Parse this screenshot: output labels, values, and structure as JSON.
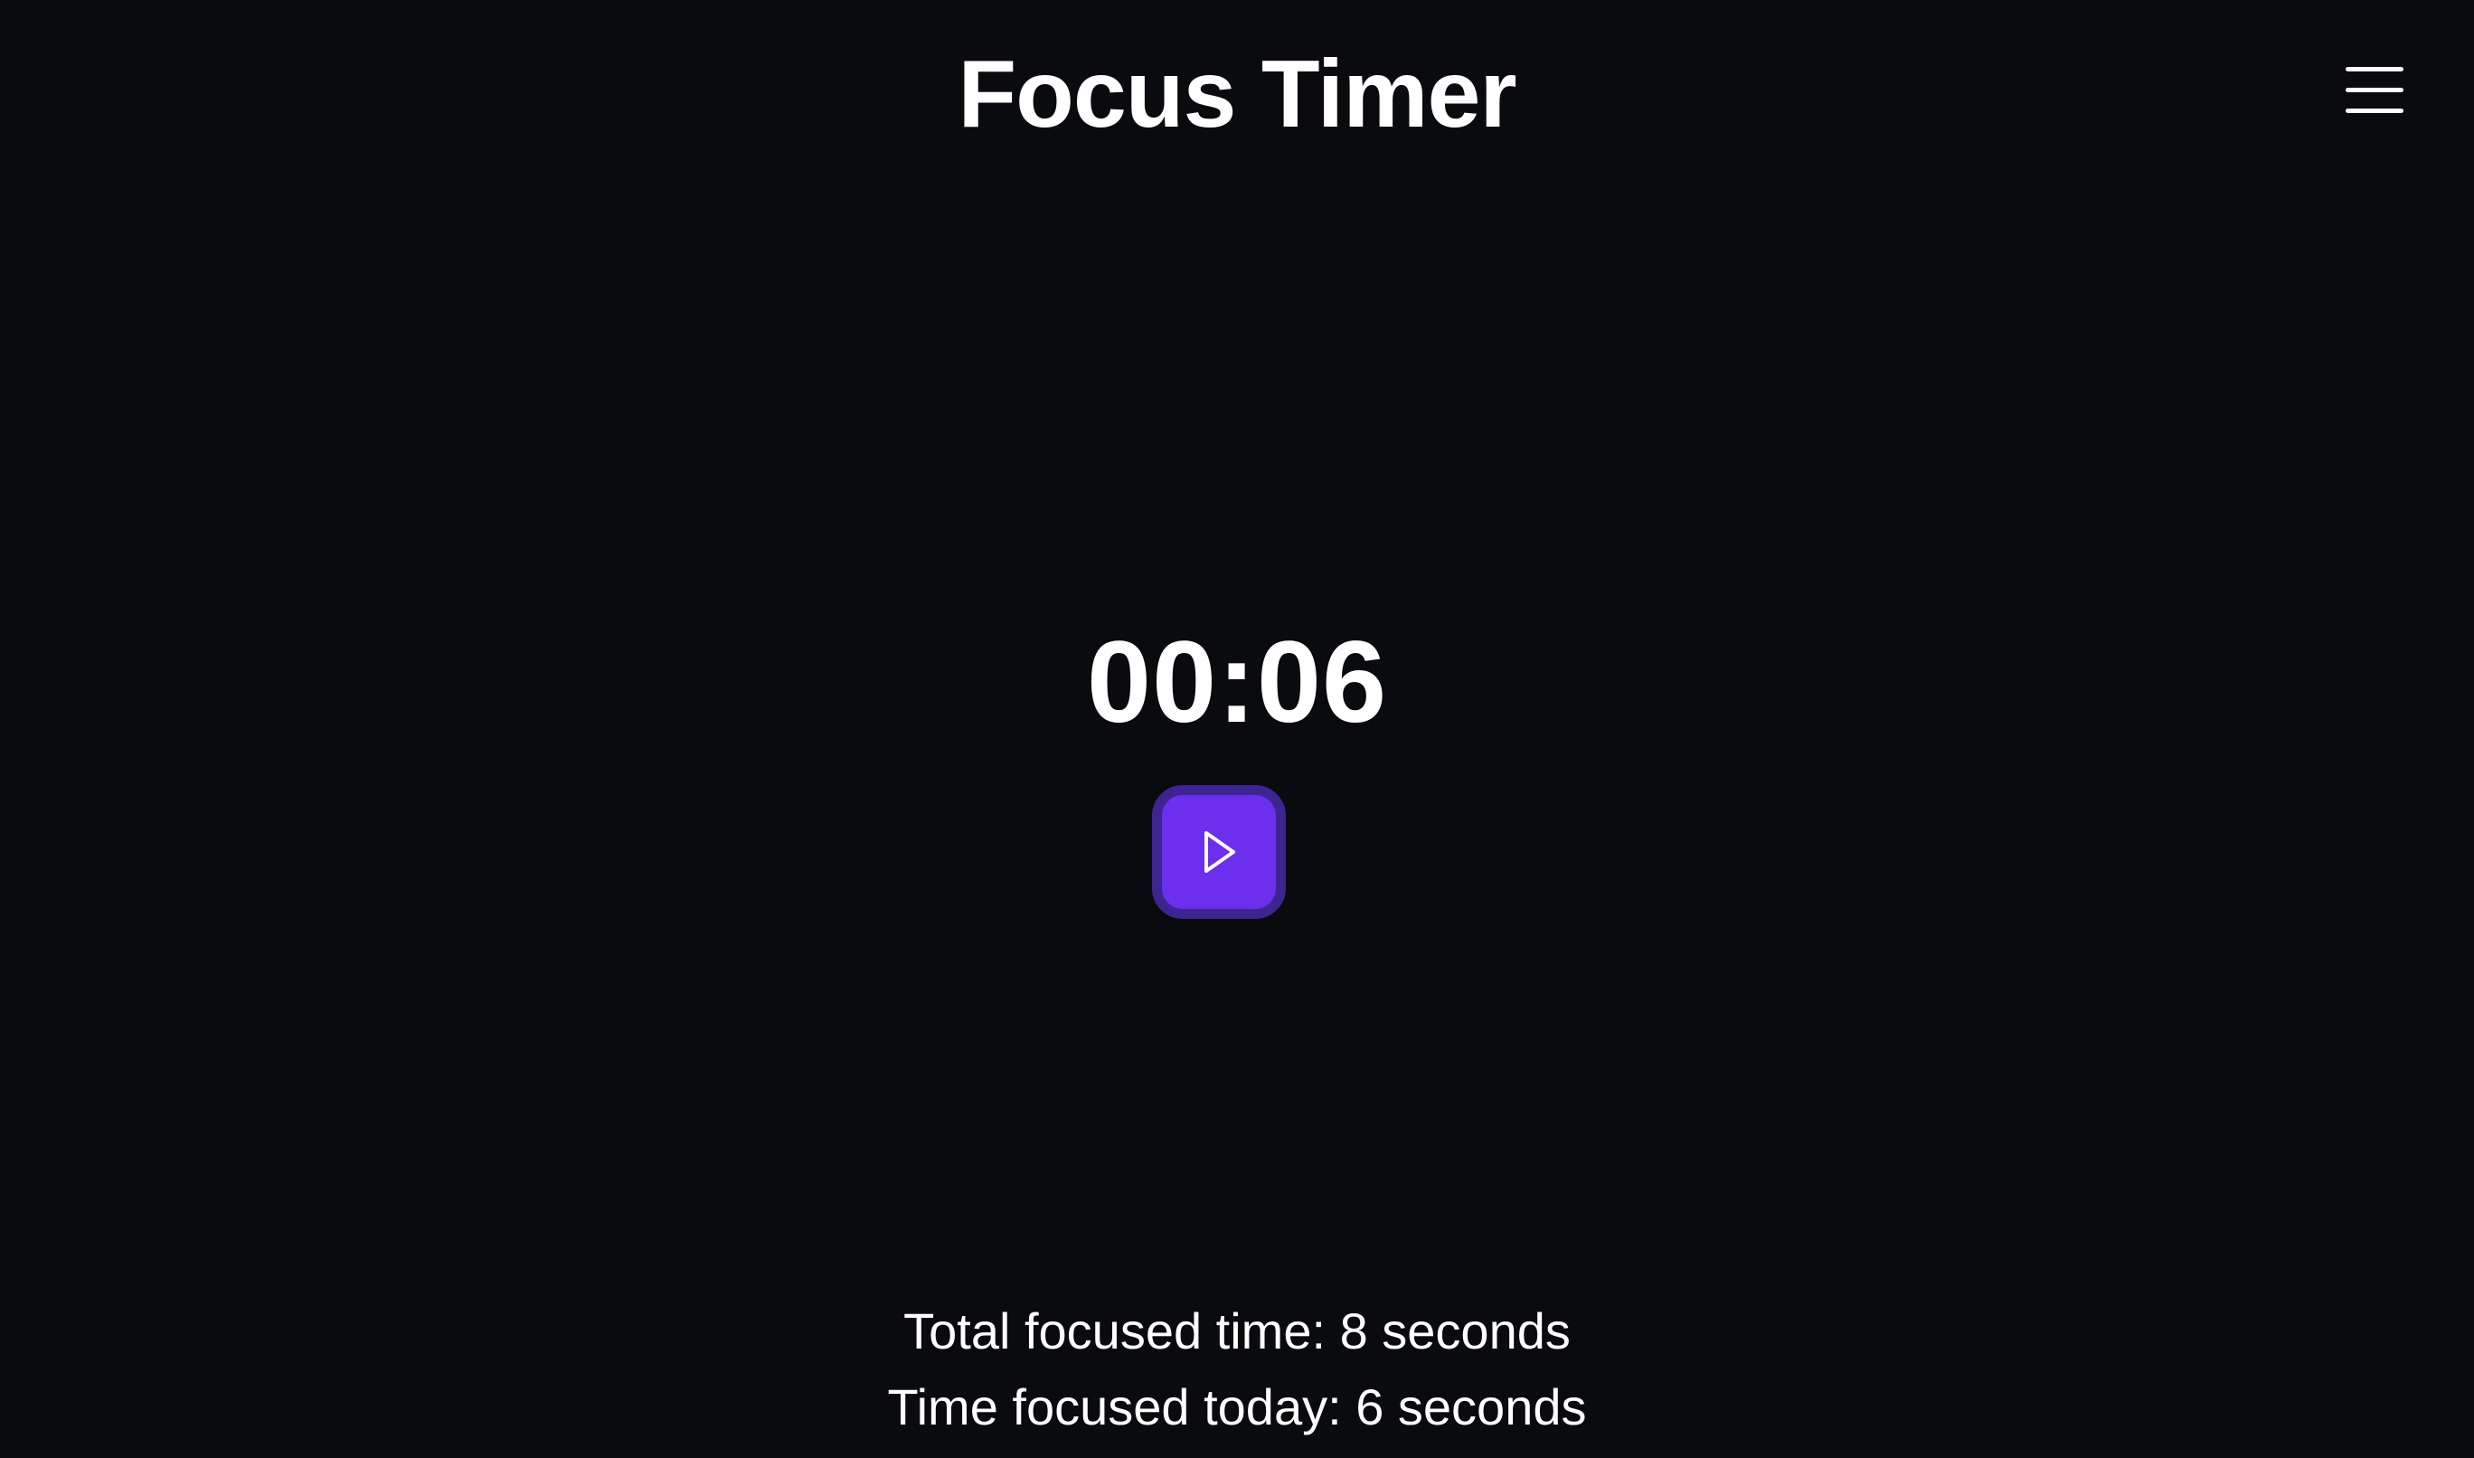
{
  "header": {
    "title": "Focus Timer",
    "menu_icon": "hamburger-menu-icon"
  },
  "timer": {
    "display": "00:06",
    "control_icon": "play-icon",
    "accent_color": "#6d2fee",
    "accent_border_color": "#3d2490"
  },
  "stats": {
    "total_focused": "Total focused time: 8 seconds",
    "focused_today": "Time focused today: 6 seconds"
  },
  "theme": {
    "background": "#0a0b0e",
    "text": "#ffffff"
  }
}
